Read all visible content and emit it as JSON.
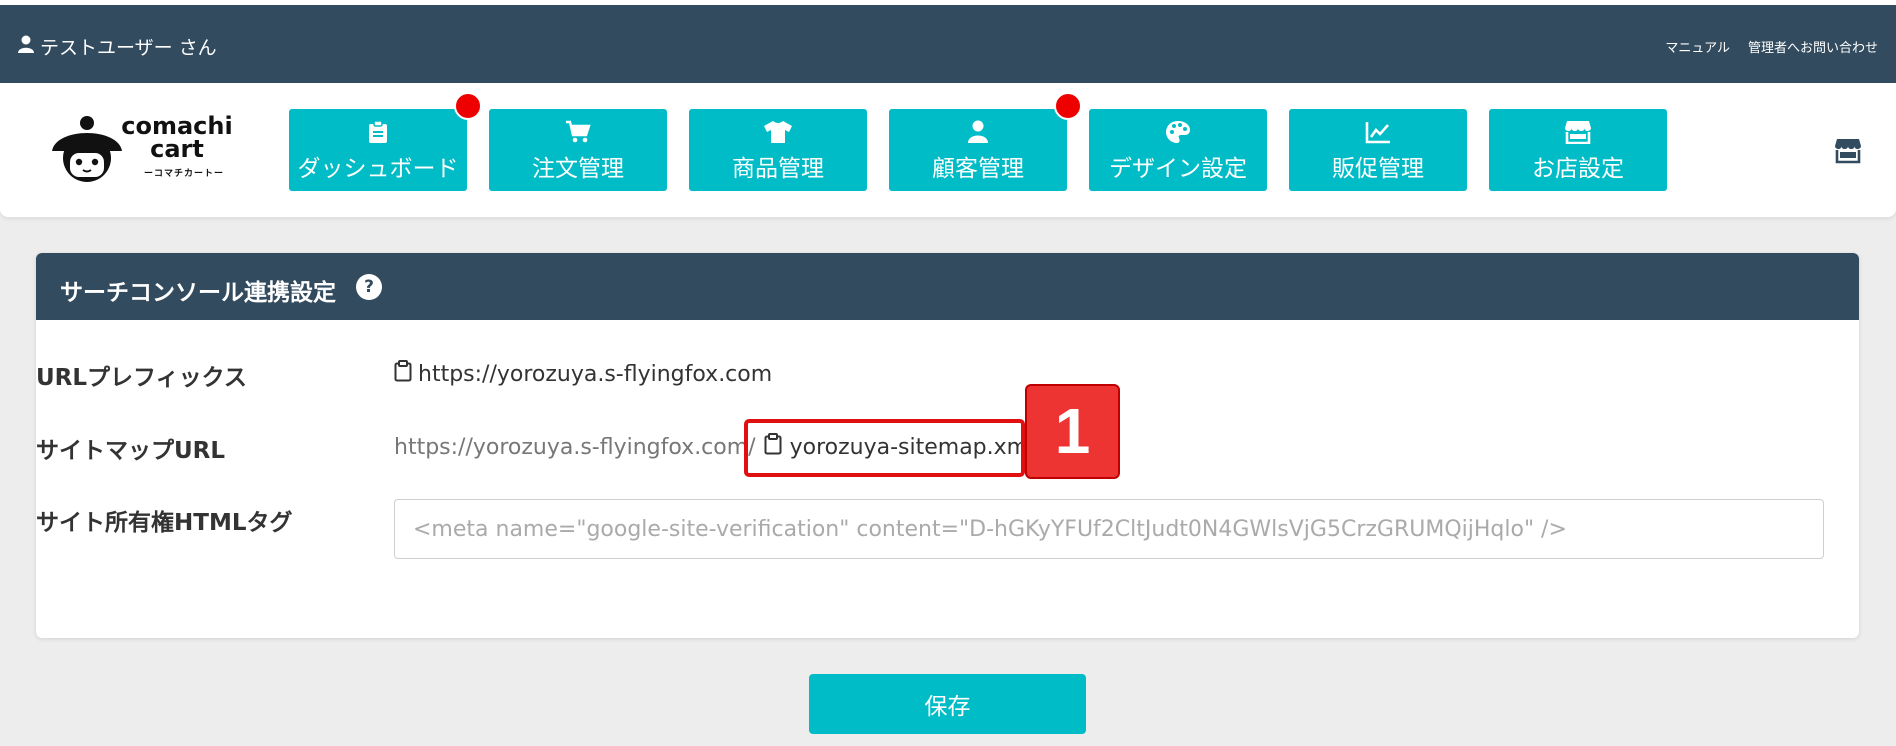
{
  "topbar": {
    "user_name": "テストユーザー さん",
    "manual_link": "マニュアル",
    "contact_link": "管理者へお問い合わせ"
  },
  "logo": {
    "brand_line1": "comachi",
    "brand_line2": "cart",
    "brand_sub": "ーコマチカートー"
  },
  "nav": {
    "items": [
      {
        "label": "ダッシュボード",
        "icon": "clipboard-icon",
        "notification": true
      },
      {
        "label": "注文管理",
        "icon": "cart-icon",
        "notification": false
      },
      {
        "label": "商品管理",
        "icon": "shirt-icon",
        "notification": false
      },
      {
        "label": "顧客管理",
        "icon": "user-icon",
        "notification": true
      },
      {
        "label": "デザイン設定",
        "icon": "palette-icon",
        "notification": false
      },
      {
        "label": "販促管理",
        "icon": "chart-line-icon",
        "notification": false
      },
      {
        "label": "お店設定",
        "icon": "store-icon",
        "notification": false
      }
    ]
  },
  "panel": {
    "title": "サーチコンソール連携設定",
    "help": "?",
    "url_prefix_label": "URLプレフィックス",
    "url_prefix_value": "https://yorozuya.s-flyingfox.com",
    "sitemap_label": "サイトマップURL",
    "sitemap_base": "https://yorozuya.s-flyingfox.com/",
    "sitemap_file": "yorozuya-sitemap.xml",
    "html_tag_label": "サイト所有権HTMLタグ",
    "html_tag_placeholder": "<meta name=\"google-site-verification\" content=\"D-hGKyYFUf2CltJudt0N4GWlsVjG5CrzGRUMQijHqlo\" />"
  },
  "annotation": {
    "step_number": "1"
  },
  "actions": {
    "save_label": "保存"
  },
  "colors": {
    "header_dark": "#324b5e",
    "accent_teal": "#00bcc6",
    "notification_red": "#ee0000",
    "highlight_red": "#e01010"
  }
}
